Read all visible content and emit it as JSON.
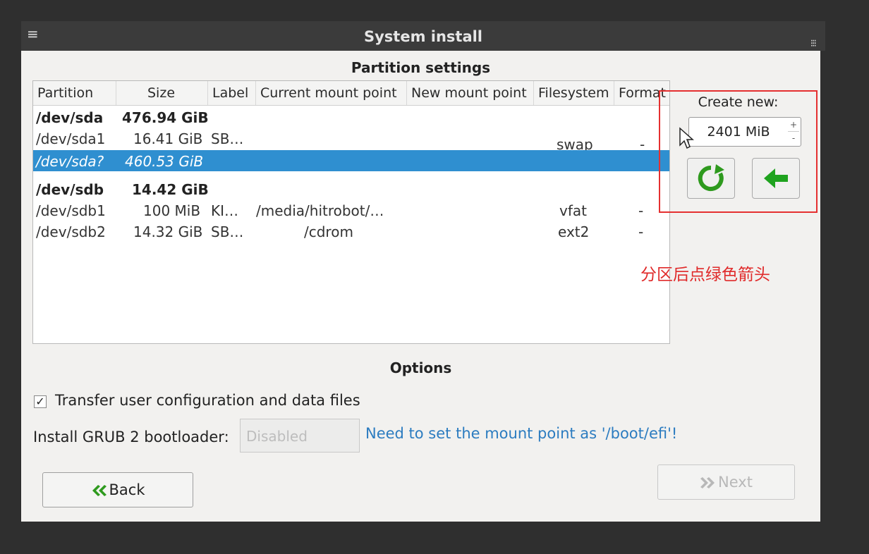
{
  "window": {
    "title": "System install",
    "pin_icon": "≡",
    "menu_icon": "⁝⁝⁝"
  },
  "partition": {
    "section_title": "Partition settings",
    "columns": [
      "Partition",
      "Size",
      "Label",
      "Current mount point",
      "New mount point",
      "Filesystem",
      "Format"
    ],
    "rows": [
      {
        "partition": "/dev/sda",
        "size": "476.94 GiB",
        "label": "",
        "current_mount": "",
        "new_mount": "",
        "filesystem": "",
        "format": "",
        "bold": true
      },
      {
        "partition": "/dev/sda1",
        "size": "16.41 GiB",
        "label": "SB…",
        "current_mount": "",
        "new_mount": "",
        "filesystem": "swap",
        "format": "-",
        "bold": false
      },
      {
        "partition": "/dev/sda?",
        "size": "460.53 GiB",
        "label": "",
        "current_mount": "",
        "new_mount": "",
        "filesystem": "",
        "format": "-",
        "bold": false,
        "selected": true
      },
      {
        "partition": "/dev/sdb",
        "size": "14.42 GiB",
        "label": "",
        "current_mount": "",
        "new_mount": "",
        "filesystem": "",
        "format": "",
        "bold": true
      },
      {
        "partition": "/dev/sdb1",
        "size": "100 MiB",
        "label": "KI…",
        "current_mount": "/media/hitrobot/…",
        "new_mount": "",
        "filesystem": "vfat",
        "format": "-",
        "bold": false
      },
      {
        "partition": "/dev/sdb2",
        "size": "14.32 GiB",
        "label": "SB…",
        "current_mount": "/cdrom",
        "new_mount": "",
        "filesystem": "ext2",
        "format": "-",
        "bold": false
      }
    ]
  },
  "create_new": {
    "label": "Create new:",
    "size_value": "2401 MiB",
    "plus": "+",
    "minus": "-",
    "refresh_icon_color": "#2e9a1e",
    "arrow_icon_color": "#1fa31f"
  },
  "annotation": "分区后点绿色箭头",
  "options": {
    "section_title": "Options",
    "transfer_checked": "✓",
    "transfer_label": "Transfer user configuration and data files",
    "grub_label": "Install GRUB 2 bootloader:",
    "grub_value": "Disabled",
    "grub_warning": "Need to set the mount point as '/boot/efi'!"
  },
  "nav": {
    "back_label": "Back",
    "next_label": "Next"
  },
  "colors": {
    "selection": "#2f8fd0",
    "annotation_red": "#e53030",
    "warning_blue": "#2c7cc0"
  }
}
